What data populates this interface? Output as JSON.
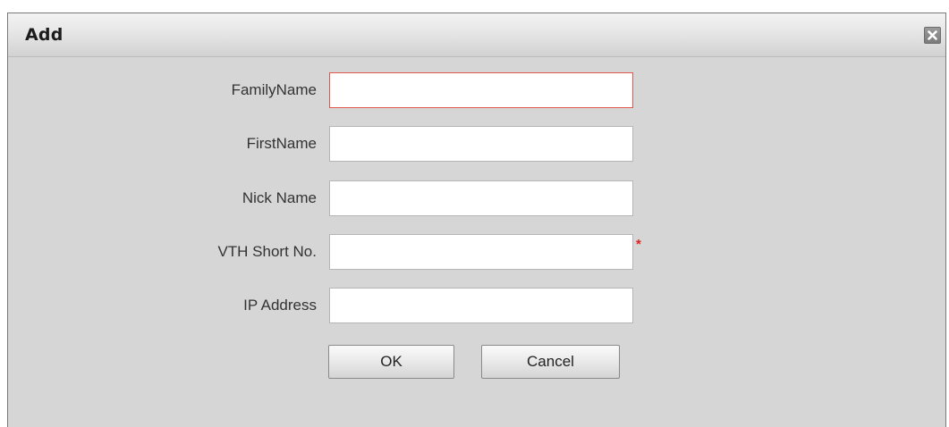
{
  "dialog": {
    "title": "Add",
    "close_icon": "close-icon"
  },
  "form": {
    "fields": [
      {
        "label": "FamilyName",
        "value": "",
        "focused": true,
        "required": false
      },
      {
        "label": "FirstName",
        "value": "",
        "focused": false,
        "required": false
      },
      {
        "label": "Nick Name",
        "value": "",
        "focused": false,
        "required": false
      },
      {
        "label": "VTH Short No.",
        "value": "",
        "focused": false,
        "required": true
      },
      {
        "label": "IP Address",
        "value": "",
        "focused": false,
        "required": false
      }
    ],
    "required_mark": "*"
  },
  "buttons": {
    "ok_label": "OK",
    "cancel_label": "Cancel"
  },
  "colors": {
    "dialog_background": "#d6d6d6",
    "focus_border": "#e2574c",
    "required_mark": "#e02020"
  }
}
